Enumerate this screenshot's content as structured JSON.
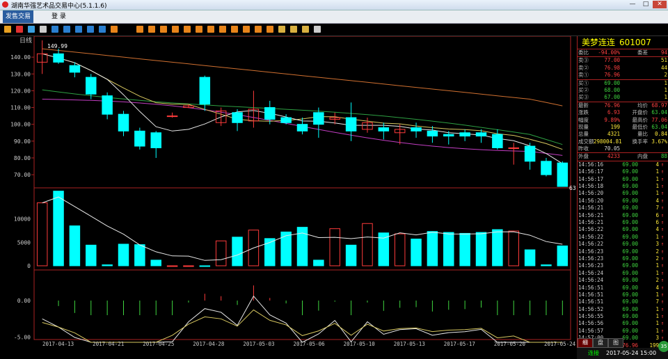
{
  "window": {
    "title": "湖南华强艺术品交易中心(5.1.1.6)",
    "min_label": "—",
    "max_label": "□",
    "close_label": "✕"
  },
  "menu": {
    "tabs": [
      {
        "label": "发售交易",
        "active": true
      },
      {
        "label": "登  录",
        "active": false
      }
    ]
  },
  "toolbar": {
    "icons": [
      "bar-chart",
      "line-chart",
      "candle",
      "screen",
      "grid",
      "list",
      "box1",
      "box2",
      "box3",
      "box4",
      "o1",
      "o2",
      "o3",
      "o4",
      "o5",
      "o6",
      "o7",
      "o8",
      "o9",
      "o10",
      "o11",
      "o12",
      "search",
      "search2",
      "edit",
      "settings"
    ]
  },
  "chart": {
    "period_label": "日线",
    "price_high_label": "149.99",
    "price_low_label": "63.04",
    "price_ticks": [
      "140.00",
      "130.00",
      "120.00",
      "110.00",
      "100.00",
      "90.00",
      "80.00",
      "70.00"
    ],
    "vol_ticks": [
      "10000",
      "5000",
      "0"
    ],
    "macd_ticks": [
      "0.00",
      "-5.00"
    ],
    "date_ticks": [
      "2017-04-13",
      "2017-04-21",
      "2017-04-25",
      "2017-04-28",
      "2017-05-03",
      "2017-05-06",
      "2017-05-10",
      "2017-05-13",
      "2017-05-17",
      "2017-05-20",
      "2017-05-24"
    ]
  },
  "chart_data": {
    "type": "candlestick",
    "x": [
      "2017-04-13",
      "2017-04-14",
      "2017-04-17",
      "2017-04-18",
      "2017-04-19",
      "2017-04-20",
      "2017-04-21",
      "2017-04-24",
      "2017-04-25",
      "2017-04-26",
      "2017-04-27",
      "2017-04-28",
      "2017-05-01",
      "2017-05-02",
      "2017-05-03",
      "2017-05-04",
      "2017-05-05",
      "2017-05-06",
      "2017-05-08",
      "2017-05-09",
      "2017-05-10",
      "2017-05-11",
      "2017-05-12",
      "2017-05-13",
      "2017-05-15",
      "2017-05-16",
      "2017-05-17",
      "2017-05-18",
      "2017-05-19",
      "2017-05-20",
      "2017-05-22",
      "2017-05-23",
      "2017-05-24"
    ],
    "open": [
      137,
      142,
      135,
      128,
      117,
      106,
      96,
      95,
      105,
      110,
      128,
      101,
      107,
      102,
      110,
      104,
      100,
      107,
      103,
      104,
      97,
      98,
      95,
      98,
      96,
      94,
      95,
      95,
      94,
      86,
      87,
      78,
      77
    ],
    "close": [
      142,
      137,
      131,
      118,
      106,
      96,
      87,
      86,
      105,
      111,
      112,
      108,
      101,
      109,
      103,
      101,
      96,
      100,
      104,
      96,
      101,
      96,
      97,
      96,
      93,
      93,
      93,
      93,
      86,
      86,
      78,
      70,
      63
    ],
    "high": [
      150,
      145,
      137,
      130,
      119,
      108,
      98,
      96,
      107,
      112,
      129,
      110,
      109,
      120,
      114,
      106,
      104,
      110,
      107,
      113,
      104,
      101,
      100,
      101,
      99,
      96,
      97,
      97,
      97,
      89,
      89,
      80,
      78
    ],
    "low": [
      130,
      136,
      128,
      115,
      103,
      93,
      85,
      80,
      104,
      110,
      108,
      99,
      96,
      98,
      100,
      100,
      94,
      92,
      100,
      90,
      95,
      91,
      88,
      92,
      89,
      88,
      90,
      89,
      85,
      76,
      73,
      69,
      63
    ],
    "volume": [
      13400,
      15900,
      8500,
      4400,
      200,
      4600,
      4500,
      1200,
      0,
      0,
      0,
      5300,
      6100,
      7600,
      5800,
      7200,
      8200,
      1200,
      7900,
      4400,
      9000,
      7000,
      6800,
      5700,
      7300,
      7100,
      6900,
      7100,
      7700,
      7400,
      3400,
      200,
      4233
    ],
    "ma5_label": "MA5",
    "price_ylim": [
      63,
      150
    ],
    "volume_ylim": [
      0,
      16000
    ]
  },
  "quote": {
    "name": "美梦连连",
    "code": "601007",
    "wei": [
      {
        "l1": "委比",
        "v1": "-94.00%",
        "l2": "委差",
        "v2": "94",
        "c1": "red",
        "c2": "red"
      }
    ],
    "sell": [
      {
        "l": "卖③",
        "p": "77.00",
        "q": "51"
      },
      {
        "l": "卖②",
        "p": "76.98",
        "q": "44"
      },
      {
        "l": "卖①",
        "p": "76.96",
        "q": "2"
      }
    ],
    "buy": [
      {
        "l": "买①",
        "p": "69.00",
        "q": "1"
      },
      {
        "l": "买②",
        "p": "68.00",
        "q": "1"
      },
      {
        "l": "买③",
        "p": "67.00",
        "q": "1"
      }
    ],
    "stats": [
      {
        "l1": "最新",
        "v1": "76.96",
        "l2": "均价",
        "v2": "68.97",
        "c1": "red",
        "c2": "red"
      },
      {
        "l1": "涨跌",
        "v1": "6.93",
        "l2": "开盘价",
        "v2": "63.04",
        "c1": "red",
        "c2": "green"
      },
      {
        "l1": "幅度",
        "v1": "9.89%",
        "l2": "最高价",
        "v2": "77.06",
        "c1": "red",
        "c2": "red"
      },
      {
        "l1": "现量",
        "v1": "199",
        "l2": "最低价",
        "v2": "63.04",
        "c1": "yellow",
        "c2": "green"
      },
      {
        "l1": "总量",
        "v1": "4321",
        "l2": "量比",
        "v2": "0.84",
        "c1": "yellow",
        "c2": "yellow"
      },
      {
        "l1": "成交额",
        "v1": "298004.81",
        "l2": "换手率",
        "v2": "3.67%",
        "c1": "yellow",
        "c2": "yellow"
      },
      {
        "l1": "昨收",
        "v1": "70.05",
        "l2": "",
        "v2": "",
        "c1": "white",
        "c2": "white"
      },
      {
        "l1": "外盘",
        "v1": "4233",
        "l2": "内盘",
        "v2": "88",
        "c1": "red",
        "c2": "green"
      }
    ],
    "ticks": [
      {
        "t": "14:56:16",
        "p": "69.00",
        "q": "4",
        "d": "↑"
      },
      {
        "t": "14:56:17",
        "p": "69.00",
        "q": "1",
        "d": "↑"
      },
      {
        "t": "14:56:17",
        "p": "69.00",
        "q": "1",
        "d": "↑"
      },
      {
        "t": "14:56:18",
        "p": "69.00",
        "q": "1",
        "d": "↑"
      },
      {
        "t": "14:56:20",
        "p": "69.00",
        "q": "1",
        "d": "↑"
      },
      {
        "t": "14:56:20",
        "p": "69.00",
        "q": "4",
        "d": "↑"
      },
      {
        "t": "14:56:21",
        "p": "69.00",
        "q": "7",
        "d": "↑"
      },
      {
        "t": "14:56:21",
        "p": "69.00",
        "q": "6",
        "d": "↑"
      },
      {
        "t": "14:56:21",
        "p": "69.00",
        "q": "6",
        "d": "↑"
      },
      {
        "t": "14:56:22",
        "p": "69.00",
        "q": "4",
        "d": "↑"
      },
      {
        "t": "14:56:22",
        "p": "69.00",
        "q": "1",
        "d": "↑"
      },
      {
        "t": "14:56:22",
        "p": "69.00",
        "q": "3",
        "d": "↑"
      },
      {
        "t": "14:56:23",
        "p": "69.00",
        "q": "2",
        "d": "↑"
      },
      {
        "t": "14:56:23",
        "p": "69.00",
        "q": "2",
        "d": "↑"
      },
      {
        "t": "14:56:23",
        "p": "69.00",
        "q": "1",
        "d": "↑"
      },
      {
        "t": "14:56:24",
        "p": "69.00",
        "q": "1",
        "d": "↑"
      },
      {
        "t": "14:56:24",
        "p": "69.00",
        "q": "2",
        "d": "↑"
      },
      {
        "t": "14:56:51",
        "p": "69.00",
        "q": "4",
        "d": "↑"
      },
      {
        "t": "14:56:51",
        "p": "69.00",
        "q": "1",
        "d": "↑"
      },
      {
        "t": "14:56:51",
        "p": "69.00",
        "q": "7",
        "d": "↑"
      },
      {
        "t": "14:56:52",
        "p": "69.00",
        "q": "1",
        "d": "↑"
      },
      {
        "t": "14:56:55",
        "p": "69.00",
        "q": "1",
        "d": "↑"
      },
      {
        "t": "14:56:56",
        "p": "69.00",
        "q": "1",
        "d": "↑"
      },
      {
        "t": "14:56:57",
        "p": "69.00",
        "q": "1",
        "d": "↑"
      },
      {
        "t": "14:57:00",
        "p": "69.00",
        "q": "3",
        "d": "↑"
      },
      {
        "t": "14:57:03",
        "p": "76.96",
        "q": "199",
        "d": "↑"
      }
    ],
    "tabs": [
      "细",
      "盘",
      "图"
    ]
  },
  "status": {
    "connection": "连接",
    "datetime": "2017-05-24 15:00"
  },
  "badge": "35",
  "colors": {
    "up": "#ff3b3b",
    "down": "#00ffff",
    "bg": "#000000",
    "frame": "#aa2222"
  }
}
